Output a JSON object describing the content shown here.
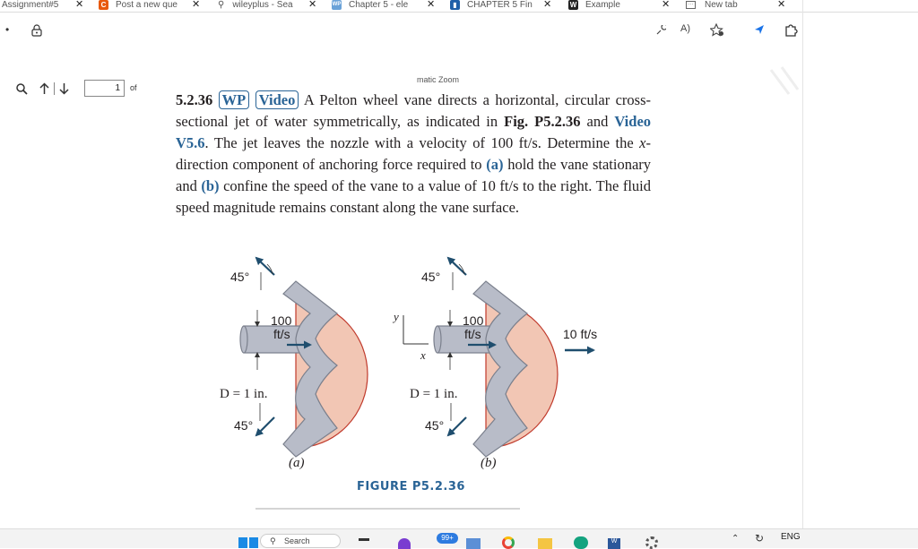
{
  "browser": {
    "tabs": [
      {
        "label": "Assignment#5",
        "favicon": ""
      },
      {
        "label": "Post a new que",
        "favicon": "C"
      },
      {
        "label": "wileyplus - Sea",
        "favicon": "search"
      },
      {
        "label": "Chapter 5 - ele",
        "favicon": "WP"
      },
      {
        "label": "CHAPTER 5 Fin",
        "favicon": "book"
      },
      {
        "label": "Example",
        "favicon": "W"
      },
      {
        "label": "New tab",
        "favicon": "newtab"
      }
    ],
    "read_aloud_label": "A)"
  },
  "pdf": {
    "page_number": "1",
    "page_of": "of",
    "overlay_label": "matic Zoom"
  },
  "problem": {
    "number": "5.2.36",
    "badge_wp": "WP",
    "badge_video": "Video",
    "text1": "A Pelton wheel vane directs a horizontal, circular cross-sectional jet of water symmetrically, as indicated in",
    "fig_ref": "Fig. P5.2.36",
    "text2": "and",
    "video_ref": "Video V5.6",
    "text3": ". The jet leaves the nozzle with a velocity of 100 ft/s. Determine the",
    "x_var": "x",
    "text4": "-direction component of anchoring force required to",
    "part_a": "(a)",
    "text5": "hold the vane stationary and",
    "part_b": "(b)",
    "text6": "confine the speed of the vane to a value of 10 ft/s to the right. The fluid speed magnitude remains constant along the vane surface."
  },
  "figure": {
    "angle_top_a": "45°",
    "angle_bottom_a": "45°",
    "velocity_a": "100",
    "velocity_unit_a": "ft/s",
    "diameter_a": "D = 1 in.",
    "label_a": "(a)",
    "axis_y": "y",
    "axis_x": "x",
    "angle_top_b": "45°",
    "angle_bottom_b": "45°",
    "velocity_b": "100",
    "velocity_unit_b": "ft/s",
    "diameter_b": "D = 1 in.",
    "label_b": "(b)",
    "vane_speed": "10 ft/s",
    "caption": "FIGURE P5.2.36"
  },
  "taskbar": {
    "search_label": "Search",
    "badge_count": "99+",
    "language": "ENG"
  },
  "colors": {
    "accent_blue": "#2a6496",
    "vane_fill": "#b8bcc8",
    "wheel_fill": "#f2c6b4",
    "wheel_stroke": "#c0392b",
    "arrow_color": "#1f4e6e"
  }
}
